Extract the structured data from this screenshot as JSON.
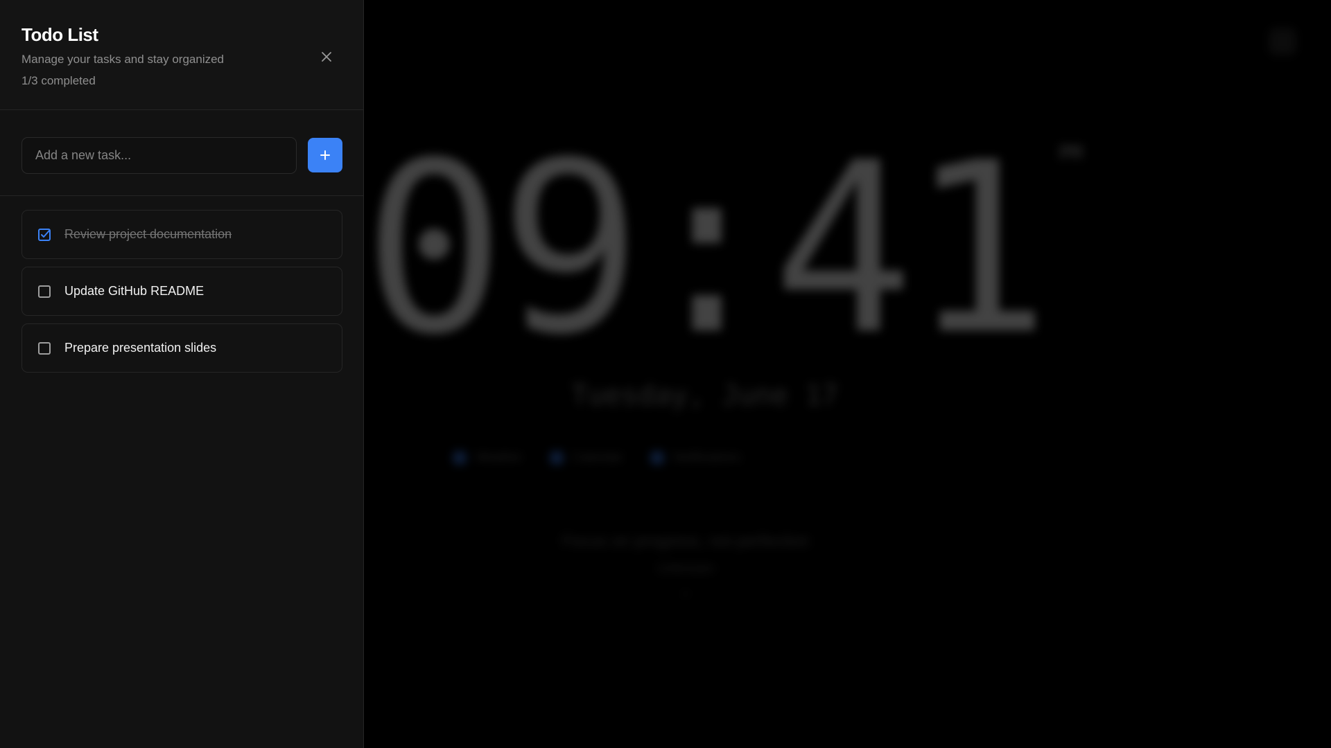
{
  "background": {
    "clock": {
      "time": "09:41",
      "period": "PM",
      "date": "Tuesday, June 17"
    },
    "chips": [
      {
        "label": "Weather"
      },
      {
        "label": "Calendar"
      },
      {
        "label": "Notifications"
      }
    ],
    "quote": {
      "text": "Focus on progress, not perfection",
      "author": "Unknown"
    }
  },
  "todo": {
    "title": "Todo List",
    "subtitle": "Manage your tasks and stay organized",
    "completed_text": "1/3 completed",
    "close_icon": "close-icon",
    "input": {
      "placeholder": "Add a new task...",
      "value": ""
    },
    "add_button": {
      "icon": "plus-icon"
    },
    "tasks": [
      {
        "label": "Review project documentation",
        "done": true
      },
      {
        "label": "Update GitHub README",
        "done": false
      },
      {
        "label": "Prepare presentation slides",
        "done": false
      }
    ]
  },
  "colors": {
    "accent": "#3b82f6",
    "panel_background": "#121212",
    "page_background": "#000000"
  }
}
